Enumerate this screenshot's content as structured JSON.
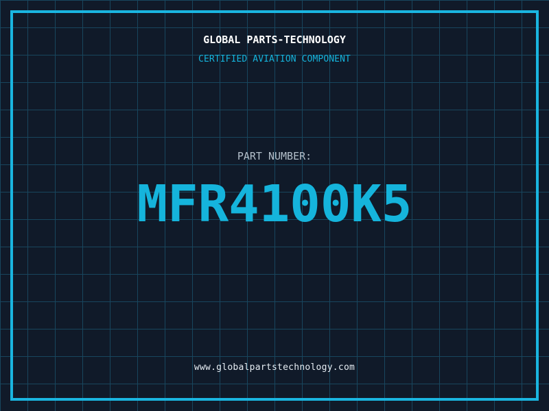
{
  "colors": {
    "background": "#101a29",
    "grid_line": "#18465e",
    "frame_border": "#1ab5e0",
    "accent_cyan": "#15b4dc",
    "header_text": "#ffffff",
    "muted_text": "#b4c0cb",
    "footer_text": "#e6edf3"
  },
  "header": {
    "title": "GLOBAL PARTS-TECHNOLOGY",
    "subtitle": "CERTIFIED AVIATION COMPONENT"
  },
  "part": {
    "label": "PART NUMBER:",
    "number": "MFR4100K5"
  },
  "footer": {
    "website": "www.globalpartstechnology.com"
  }
}
